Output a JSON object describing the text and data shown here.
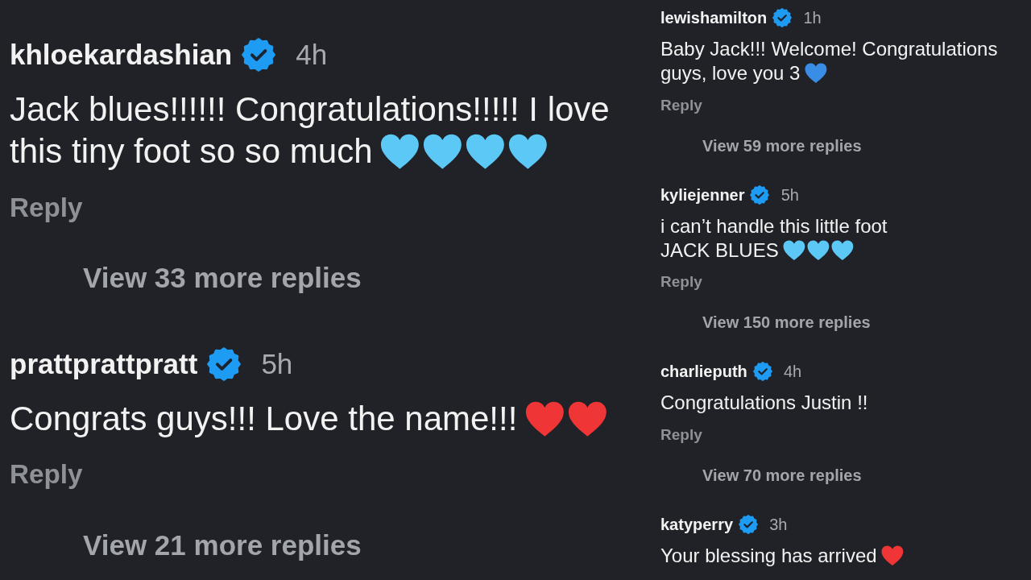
{
  "left_column": {
    "comments": [
      {
        "username": "khloekardashian",
        "verified": true,
        "time": "4h",
        "text": "Jack blues!!!!!! Congratulations!!!!! I love this tiny foot so so much",
        "hearts": [
          {
            "color": "#5cc8f6"
          },
          {
            "color": "#5cc8f6"
          },
          {
            "color": "#5cc8f6"
          },
          {
            "color": "#5cc8f6"
          }
        ],
        "reply_label": "Reply",
        "view_replies": "View 33 more replies"
      },
      {
        "username": "prattprattpratt",
        "verified": true,
        "time": "5h",
        "text": "Congrats guys!!! Love the name!!!",
        "hearts": [
          {
            "color": "#ef3535"
          },
          {
            "color": "#ef3535"
          }
        ],
        "reply_label": "Reply",
        "view_replies": "View 21 more replies"
      }
    ]
  },
  "right_column": {
    "comments": [
      {
        "username": "lewishamilton",
        "verified": true,
        "time": "1h",
        "text": "Baby Jack!!! Welcome! Congratulations guys, love you 3",
        "hearts": [
          {
            "color": "#3a8de6"
          }
        ],
        "reply_label": "Reply",
        "view_replies": "View 59 more replies"
      },
      {
        "username": "kyliejenner",
        "verified": true,
        "time": "5h",
        "text": "i can’t handle this little foot\nJACK BLUES",
        "hearts": [
          {
            "color": "#5cc8f6"
          },
          {
            "color": "#5cc8f6"
          },
          {
            "color": "#5cc8f6"
          }
        ],
        "reply_label": "Reply",
        "view_replies": "View 150 more replies"
      },
      {
        "username": "charlieputh",
        "verified": true,
        "time": "4h",
        "text": "Congratulations Justin !!",
        "reply_label": "Reply",
        "view_replies": "View 70 more replies"
      },
      {
        "username": "katyperry",
        "verified": true,
        "time": "3h",
        "text": "Your blessing has arrived",
        "hearts": [
          {
            "color": "#ef3535"
          }
        ]
      }
    ]
  }
}
